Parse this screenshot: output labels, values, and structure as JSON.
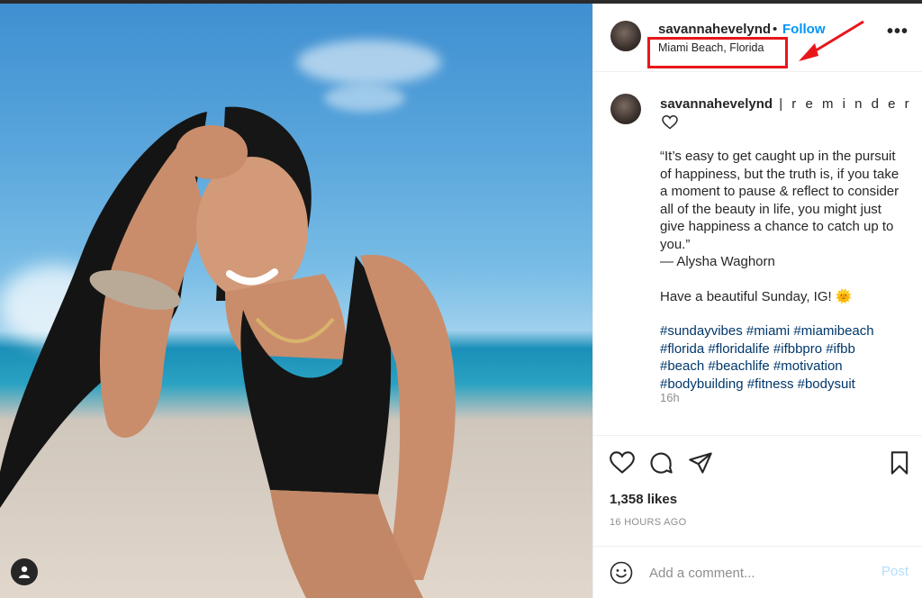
{
  "post": {
    "username": "savannahevelynd",
    "separator": "•",
    "follow_label": "Follow",
    "location": "Miami Beach, Florida",
    "more_label": "•••"
  },
  "caption": {
    "username": "savannahevelynd",
    "title": " | r e m i n d e r",
    "quote_lines": [
      "“It’s easy to get caught up in the pursuit",
      "of happiness, but the truth is, if you take",
      "a moment to pause & reflect to consider",
      "all of the beauty in life, you might just",
      "give happiness a chance to catch up to",
      "you.”",
      "— Alysha Waghorn"
    ],
    "greeting": "Have a beautiful Sunday, IG! 🌞",
    "hashtag_lines": [
      "#sundayvibes #miami #miamibeach",
      "#florida #floridalife #ifbbpro #ifbb",
      "#beach #beachlife #motivation",
      "#bodybuilding #fitness #bodysuit"
    ],
    "time_ago": "16h"
  },
  "stats": {
    "likes": "1,358 likes",
    "posted": "16 HOURS AGO"
  },
  "comment": {
    "placeholder": "Add a comment...",
    "post_label": "Post"
  },
  "icons": [
    "heart-icon",
    "comment-icon",
    "share-icon",
    "bookmark-icon",
    "emoji-icon",
    "more-icon",
    "user-icon"
  ],
  "colors": {
    "link_blue": "#0095f6",
    "hashtag": "#00376b",
    "highlight": "#e8161b",
    "muted": "#8e8e8e"
  }
}
